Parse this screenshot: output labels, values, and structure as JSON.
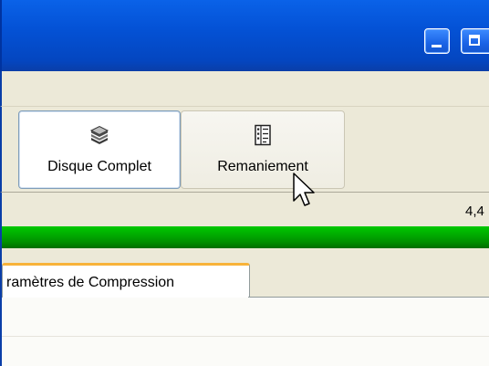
{
  "toolbar": {
    "items": [
      {
        "label": "Disque Complet",
        "icon": "disk-stack-icon",
        "state": "pressed"
      },
      {
        "label": "Remaniement",
        "icon": "document-list-icon",
        "state": "hover"
      }
    ]
  },
  "status": {
    "value": "4,4"
  },
  "progress": {
    "fraction": 1.0,
    "color": "#009a00"
  },
  "tabs": [
    {
      "label": "ramètres de Compression",
      "active": true
    }
  ],
  "colors": {
    "titlebar": "#0452d6",
    "chrome": "#ece9d8",
    "tab_highlight": "#f8b33a"
  }
}
